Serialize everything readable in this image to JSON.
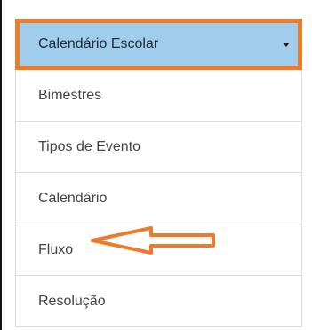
{
  "menu": {
    "header_label": "Calendário Escolar",
    "items": [
      {
        "label": "Bimestres"
      },
      {
        "label": "Tipos de Evento"
      },
      {
        "label": "Calendário"
      },
      {
        "label": "Fluxo"
      },
      {
        "label": "Resolução"
      }
    ]
  },
  "annotations": {
    "highlight_color": "#ee7a2c",
    "header_background": "#9fcdeb",
    "arrow_target": "Fluxo"
  }
}
